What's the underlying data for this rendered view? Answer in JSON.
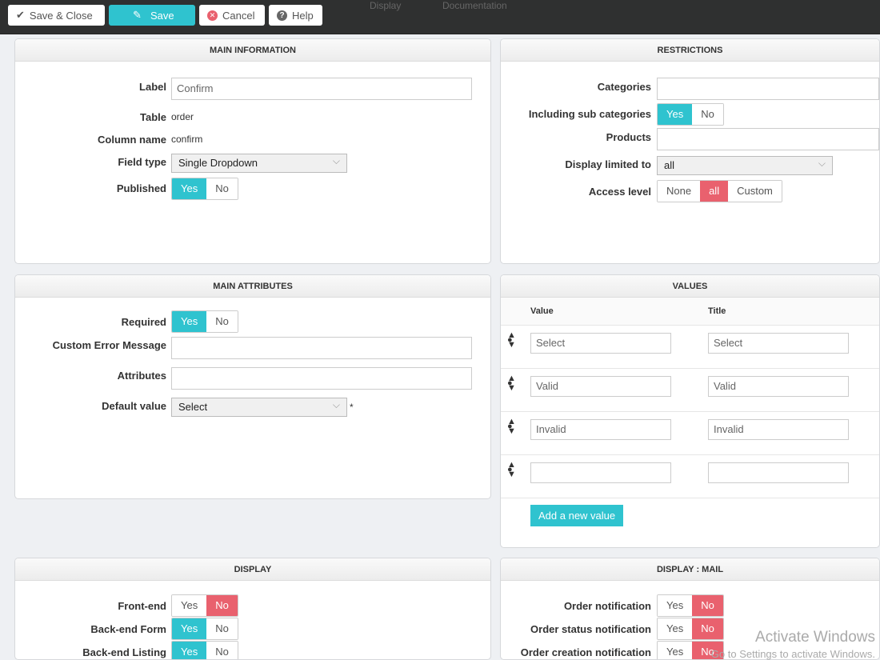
{
  "topnav": {
    "items": [
      "Display",
      "Documentation"
    ]
  },
  "toolbar": {
    "save_close": "Save & Close",
    "save": "Save",
    "cancel": "Cancel",
    "help": "Help"
  },
  "main_info": {
    "title": "MAIN INFORMATION",
    "label_label": "Label",
    "label_value": "Confirm",
    "table_label": "Table",
    "table_value": "order",
    "column_label": "Column name",
    "column_value": "confirm",
    "fieldtype_label": "Field type",
    "fieldtype_value": "Single Dropdown",
    "published_label": "Published",
    "yes": "Yes",
    "no": "No"
  },
  "restrictions": {
    "title": "RESTRICTIONS",
    "categories": "Categories",
    "subcats": "Including sub categories",
    "products": "Products",
    "display_limited": "Display limited to",
    "display_limited_value": "all",
    "access_level": "Access level",
    "access_options": [
      "None",
      "all",
      "Custom"
    ],
    "yes": "Yes",
    "no": "No"
  },
  "main_attr": {
    "title": "MAIN ATTRIBUTES",
    "required": "Required",
    "custom_error": "Custom Error Message",
    "attributes": "Attributes",
    "default_value": "Default value",
    "default_value_selected": "Select",
    "asterisk": "*",
    "yes": "Yes",
    "no": "No"
  },
  "values": {
    "title": "VALUES",
    "col_value": "Value",
    "col_title": "Title",
    "rows": [
      {
        "value": "Select",
        "title": "Select"
      },
      {
        "value": "Valid",
        "title": "Valid"
      },
      {
        "value": "Invalid",
        "title": "Invalid"
      },
      {
        "value": "",
        "title": ""
      }
    ],
    "add": "Add a new value"
  },
  "display": {
    "title": "DISPLAY",
    "rows": [
      {
        "label": "Front-end",
        "state": "No"
      },
      {
        "label": "Back-end Form",
        "state": "Yes"
      },
      {
        "label": "Back-end Listing",
        "state": "Yes"
      }
    ],
    "yes": "Yes",
    "no": "No"
  },
  "display_mail": {
    "title": "DISPLAY : MAIL",
    "rows": [
      {
        "label": "Order notification",
        "state": "No"
      },
      {
        "label": "Order status notification",
        "state": "No"
      },
      {
        "label": "Order creation notification",
        "state": "No"
      }
    ],
    "yes": "Yes",
    "no": "No"
  },
  "watermark": {
    "line1": "Activate Windows",
    "line2": "Go to Settings to activate Windows."
  },
  "colors": {
    "accent": "#2fc3cf",
    "danger": "#e9616e",
    "topbar": "#2f3030"
  }
}
